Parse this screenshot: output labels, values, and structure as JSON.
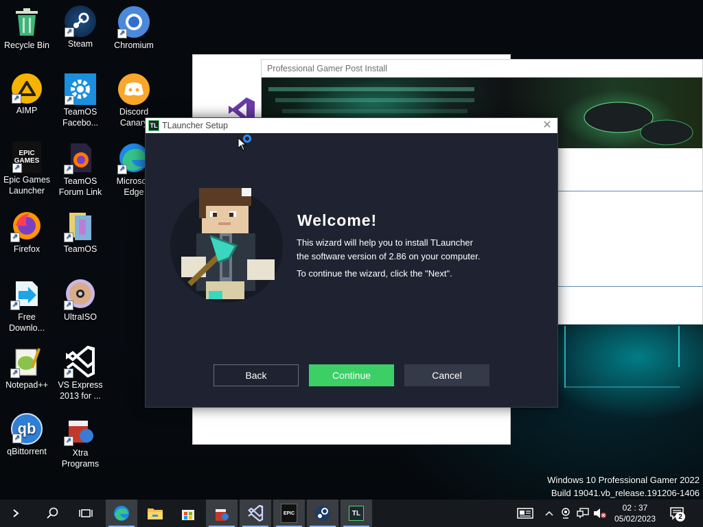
{
  "desktop": {
    "icons": [
      {
        "label": "Recycle Bin"
      },
      {
        "label": "Steam"
      },
      {
        "label": "Chromium"
      },
      {
        "label": "AIMP"
      },
      {
        "label": "TeamOS Facebo..."
      },
      {
        "label": "Discord Canary"
      },
      {
        "label": "Epic Games Launcher"
      },
      {
        "label": "TeamOS Forum Link"
      },
      {
        "label": "Microsoft Edge"
      },
      {
        "label": "Firefox"
      },
      {
        "label": "TeamOS"
      },
      {
        "label": "Free Downlo..."
      },
      {
        "label": "UltraISO"
      },
      {
        "label": "Notepad++"
      },
      {
        "label": "VS Express 2013 for ..."
      },
      {
        "label": "qBittorrent"
      },
      {
        "label": "Xtra Programs"
      }
    ],
    "icon_glyphs": {
      "epic": "EPIC\nGAMES",
      "qbittorrent": "qb"
    }
  },
  "background_window": {
    "title": "Professional Gamer Post Install"
  },
  "dialog": {
    "title": "TLauncher Setup",
    "badge": "TL",
    "close": "✕",
    "welcome": "Welcome!",
    "description_line1": "This wizard will help you to install TLauncher",
    "description_line2": "the software version of 2.86 on your computer.",
    "instruction": "To continue the wizard, click the \"Next\".",
    "buttons": {
      "back": "Back",
      "continue": "Continue",
      "cancel": "Cancel"
    },
    "colors": {
      "background": "#1f2331",
      "continue": "#3ccf66",
      "cancel": "#353a48"
    }
  },
  "watermark": {
    "line1": "Windows 10 Professional Gamer 2022",
    "line2": "Build 19041.vb_release.191206-1406"
  },
  "taskbar": {
    "apps": [
      {
        "icon": "edge-icon"
      },
      {
        "icon": "file-explorer-icon"
      },
      {
        "icon": "store-icon"
      },
      {
        "icon": "xtra-programs-icon"
      },
      {
        "icon": "visual-studio-icon"
      },
      {
        "icon": "epic-games-icon"
      },
      {
        "icon": "steam-icon"
      },
      {
        "icon": "tlauncher-icon"
      }
    ],
    "epic_badge": "EPIC",
    "tl_badge": "TL",
    "tray": {
      "time": "02 : 37",
      "date": "05/02/2023",
      "notification_count": "2"
    }
  }
}
